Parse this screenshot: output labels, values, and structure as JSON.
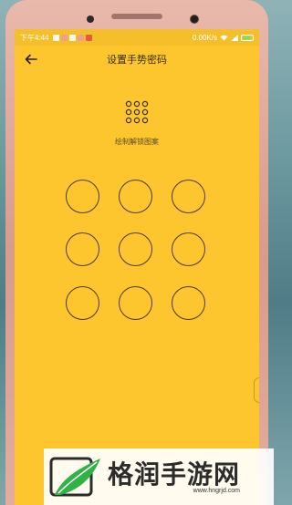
{
  "statusbar": {
    "time": "下午4:44",
    "network_speed": "0.00K/s",
    "battery_level": 0.8,
    "icons": [
      "notification-icon",
      "app-icon",
      "notification-icon",
      "app-icon",
      "app-icon"
    ]
  },
  "header": {
    "title": "设置手势密码",
    "back_icon": "arrow-left-icon"
  },
  "pattern_section": {
    "icon": "pattern-grid-icon",
    "hint": "绘制解锁图案",
    "dots": [
      "1",
      "2",
      "3",
      "4",
      "5",
      "6",
      "7",
      "8",
      "9"
    ]
  },
  "watermark": {
    "brand": "格润手游网",
    "url": "www.hngrjd.com"
  },
  "colors": {
    "background": "#fec62e",
    "status_bar": "#f5bf2b",
    "dot_border": "#4a3a16",
    "phone_frame": "#e0a898"
  }
}
